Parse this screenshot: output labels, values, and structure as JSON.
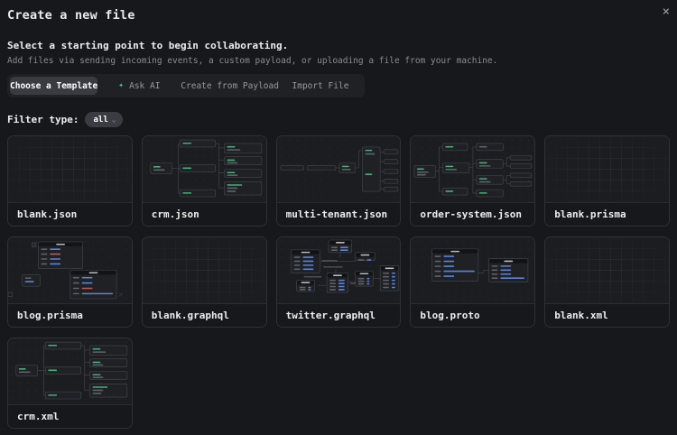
{
  "dialog": {
    "title": "Create a new file",
    "subtitle": "Select a starting point to begin collaborating.",
    "description": "Add files via sending incoming events, a custom payload, or uploading a file from your machine.",
    "icons": {
      "close": "×",
      "sparkle": "✦",
      "chevron_down": "⌄"
    },
    "tabs": [
      {
        "label": "Choose a Template",
        "selected": true
      },
      {
        "label": "Ask AI",
        "selected": false,
        "icon": "sparkle-icon"
      },
      {
        "label": "Create from Payload",
        "selected": false
      },
      {
        "label": "Import File",
        "selected": false
      }
    ],
    "filter": {
      "label": "Filter type:",
      "value": "all"
    },
    "templates": [
      {
        "filename": "blank.json",
        "preview": "blank-grid"
      },
      {
        "filename": "crm.json",
        "preview": "tree-diagram"
      },
      {
        "filename": "multi-tenant.json",
        "preview": "chain-diagram"
      },
      {
        "filename": "order-system.json",
        "preview": "branch-diagram"
      },
      {
        "filename": "blank.prisma",
        "preview": "blank-grid"
      },
      {
        "filename": "blog.prisma",
        "preview": "overlap-tables"
      },
      {
        "filename": "blank.graphql",
        "preview": "blank-grid"
      },
      {
        "filename": "twitter.graphql",
        "preview": "scatter-tables"
      },
      {
        "filename": "blog.proto",
        "preview": "pair-tables"
      },
      {
        "filename": "blank.xml",
        "preview": "blank-grid"
      },
      {
        "filename": "crm.xml",
        "preview": "tree-diagram"
      }
    ],
    "colors": {
      "accent_green": "#3fc06f",
      "preview_green": "#45b077",
      "preview_blue": "#5b84d9",
      "preview_red": "#bf5a55"
    }
  }
}
